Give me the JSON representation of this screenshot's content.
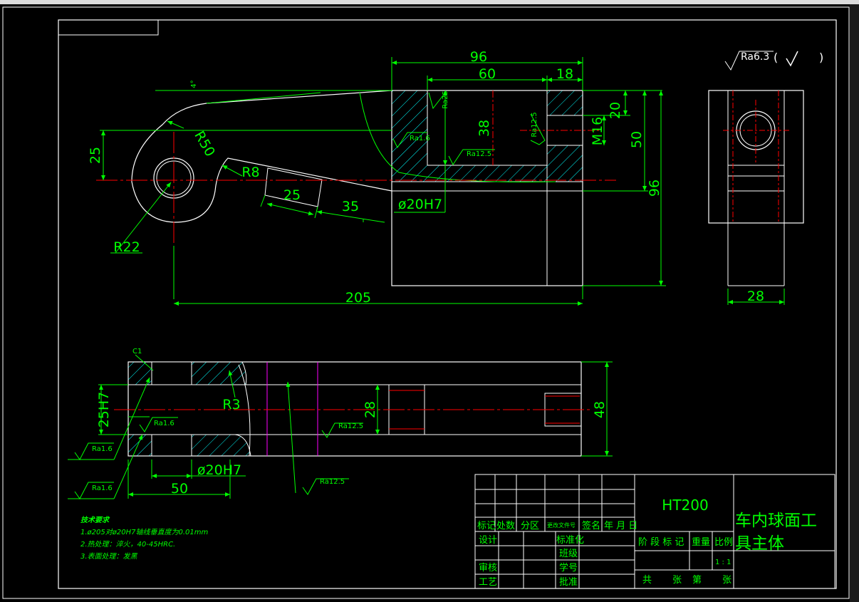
{
  "drawing": {
    "dims": {
      "d96_top": "96",
      "d60": "60",
      "d18": "18",
      "d4deg": "4°",
      "d20": "20",
      "d38": "38",
      "d50_right": "50",
      "d96_right": "96",
      "m16": "M16",
      "d25_left": "25",
      "r50": "R50",
      "r8": "R8",
      "d25_slot": "25",
      "d35": "35",
      "phi20h7_top": "ø20H7",
      "r22": "R22",
      "d205": "205",
      "d28_side": "28",
      "c1": "C1",
      "h25h7": "25H7",
      "r3": "R3",
      "d28_bottom": "28",
      "d48": "48",
      "phi20h7_bottom": "ø20H7",
      "d50_bottom": "50"
    },
    "roughness": {
      "ra63_top": "Ra6.3",
      "ra63_paren_open": "(",
      "ra63_paren_close": ")",
      "ra25_a": "Ra25",
      "ra16_a": "Ra1.6",
      "ra125_a": "Ra12.5",
      "ra125_b": "Ra12.5",
      "ra16_b": "Ra1.6",
      "ra16_c": "Ra1.6",
      "ra16_d": "Ra1.6",
      "ra125_c": "Ra12.5",
      "ra125_d": "Ra12.5"
    },
    "notes": {
      "title": "技术要求",
      "line1": "1.ø205对ø20H7轴线垂直度为0.01mm",
      "line2": "2.热处理：淬火，40-45HRC.",
      "line3": "3.表面处理：发黑"
    },
    "title_block": {
      "material": "HT200",
      "part_name_1": "车内球面工",
      "part_name_2": "具主体",
      "mark": "标记",
      "count": "处数",
      "zone": "分区",
      "doc_no": "更改文件号",
      "sign": "签名",
      "date": "年 月 日",
      "design": "设计",
      "standard": "标准化",
      "class": "班级",
      "review": "审核",
      "student_no": "学号",
      "process": "工艺",
      "approve": "批准",
      "stage": "阶 段 标 记",
      "weight": "重量",
      "scale": "比例",
      "scale_value": "1 : 1",
      "total": "共",
      "sheets1": "张",
      "nth": "第",
      "sheets2": "张"
    }
  },
  "colors": {
    "outline": "#ffffff",
    "dimension": "#00ff00",
    "centerline": "#ff0000",
    "hatch": "#00ffff",
    "section": "#ff00ff",
    "background": "#000000"
  }
}
